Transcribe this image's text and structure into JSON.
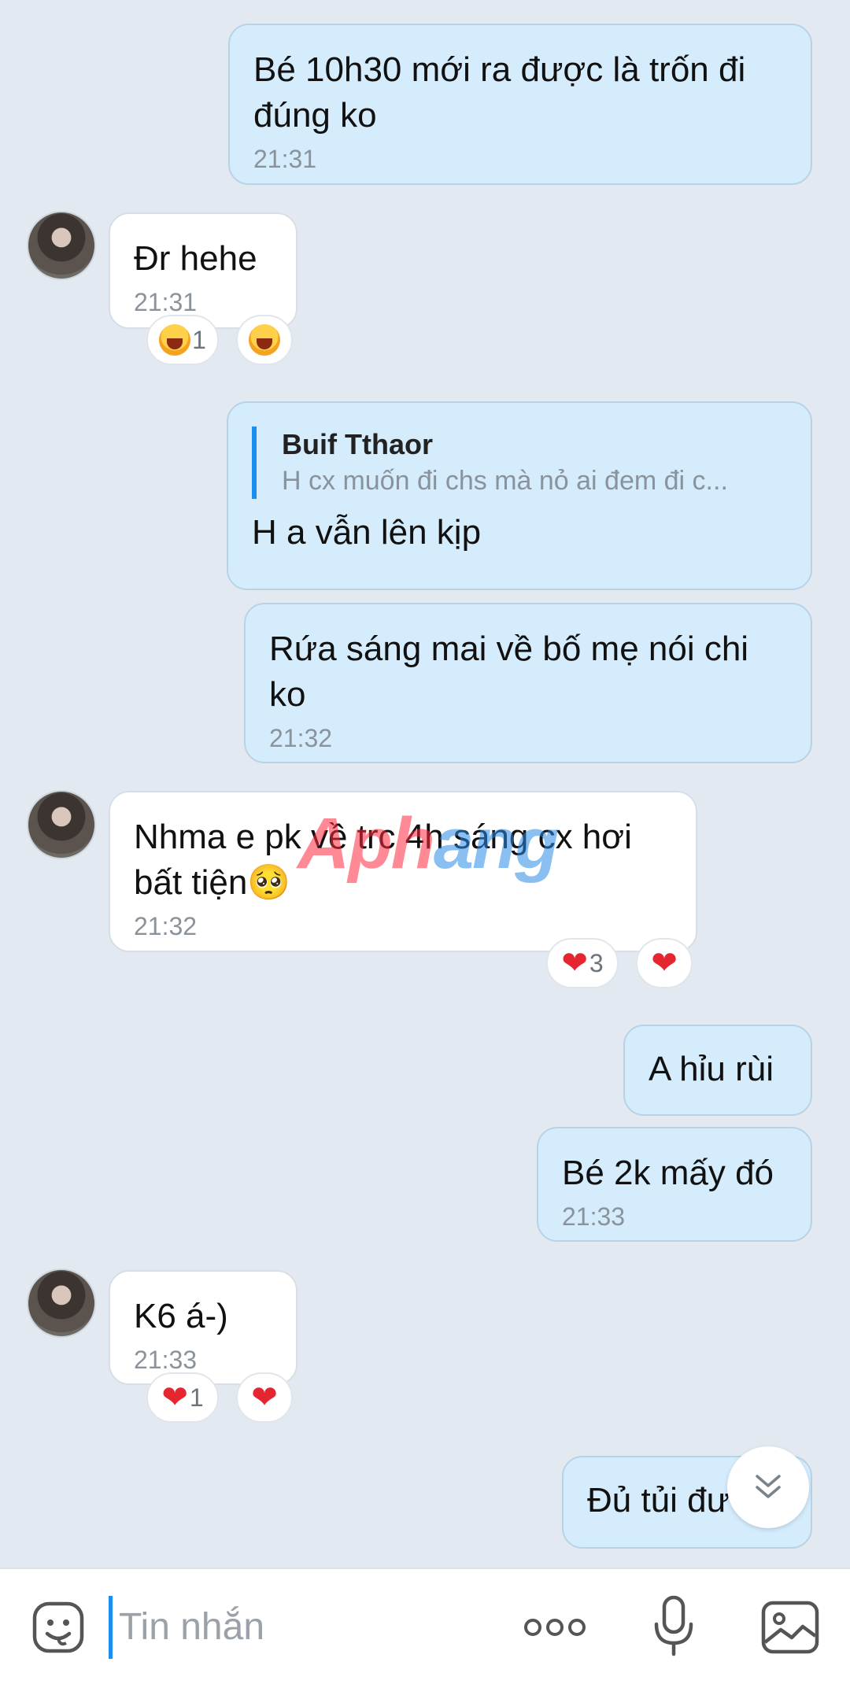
{
  "messages": [
    {
      "text": "Bé 10h30 mới ra được là trốn đi đúng ko",
      "time": "21:31"
    },
    {
      "text": "Đr hehe",
      "time": "21:31",
      "reaction_count": "1"
    },
    {
      "quote_name": "Buif Tthaor",
      "quote_text": "H cx muốn đi chs mà nỏ ai đem đi c...",
      "text": "H a vẫn lên kịp"
    },
    {
      "text": "Rứa sáng mai về bố mẹ nói chi ko",
      "time": "21:32"
    },
    {
      "text": "Nhma e pk về trc 4h sáng cx hơi bất tiện🥺",
      "time": "21:32",
      "reaction_count": "3"
    },
    {
      "text": "A hỉu rùi"
    },
    {
      "text": "Bé 2k mấy đó",
      "time": "21:33"
    },
    {
      "text": "K6 á-)",
      "time": "21:33",
      "reaction_count": "1"
    },
    {
      "text": "Đủ tủi đư"
    }
  ],
  "watermark": {
    "part1": "Aph",
    "part2": "ang"
  },
  "composer": {
    "placeholder": "Tin nhắn"
  },
  "icons": [
    "sticker-icon",
    "more-icon",
    "microphone-icon",
    "image-icon",
    "scroll-down-icon",
    "heart-icon",
    "laugh-icon"
  ],
  "colors": {
    "outgoing_bubble": "#d4ecfc",
    "incoming_bubble": "#ffffff",
    "background": "#e2e9f1",
    "accent": "#1c8ef2",
    "heart": "#e3262f"
  }
}
